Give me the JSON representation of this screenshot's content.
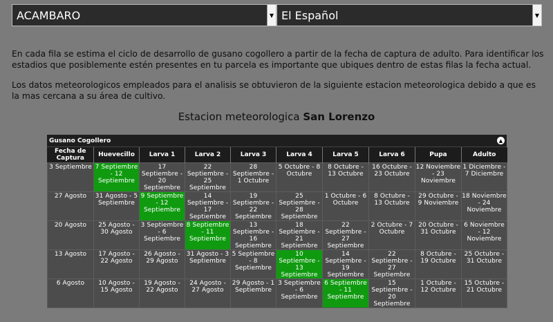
{
  "selects": {
    "city": "ACAMBARO",
    "language": "El Español"
  },
  "intro": {
    "p1": "En cada fila se estima el ciclo de desarrollo de gusano cogollero a partir de la fecha de captura de adulto. Para identificar los estadios que posiblemente estén presentes en tu parcela es importante que ubiques dentro de estas filas la fecha actual.",
    "p2": "Los datos meteorologicos empleados para el analisis se obtuvieron de la siguiente estacion meteorologica debido a que es la mas cercana a su área de cultivo."
  },
  "station": {
    "prefix": "Estacion meteorologica",
    "name": "San Lorenzo"
  },
  "panel": {
    "title": "Gusano Cogollero",
    "columns": [
      "Fecha de Captura",
      "Huevecillo",
      "Larva 1",
      "Larva 2",
      "Larva 3",
      "Larva 4",
      "Larva 5",
      "Larva 6",
      "Pupa",
      "Adulto"
    ],
    "rows": [
      {
        "cells": [
          "3 Septiembre",
          "7 Septiembre - 12 Septiembre",
          "17 Septiembre - 20 Septiembre",
          "22 Septiembre - 25 Septiembre",
          "28 Septiembre - 1 Octubre",
          "5 Octubre - 8 Octubre",
          "8 Octubre - 13 Octubre",
          "16 Octubre - 23 Octubre",
          "12 Noviembre - 23 Noviembre",
          "1 Diciembre - 7 Diciembre"
        ],
        "current": 1
      },
      {
        "cells": [
          "27 Agosto",
          "31 Agosto - 5 Septiembre",
          "9 Septiembre - 12 Septiembre",
          "14 Septiembre - 17 Septiembre",
          "19 Septiembre - 22 Septiembre",
          "25 Septiembre - 28 Septiembre",
          "1 Octubre - 6 Octubre",
          "8 Octubre - 13 Octubre",
          "29 Octubre - 9 Noviembre",
          "18 Noviembre - 24 Noviembre"
        ],
        "current": 2
      },
      {
        "cells": [
          "20 Agosto",
          "25 Agosto - 30 Agosto",
          "3 Septiembre - 6 Septiembre",
          "8 Septiembre - 11 Septiembre",
          "13 Septiembre - 16 Septiembre",
          "18 Septiembre - 21 Septiembre",
          "22 Septiembre - 27 Septiembre",
          "2 Octubre - 7 Octubre",
          "20 Octubre - 31 Octubre",
          "6 Noviembre - 12 Noviembre"
        ],
        "current": 3
      },
      {
        "cells": [
          "13 Agosto",
          "17 Agosto - 22 Agosto",
          "26 Agosto - 29 Agosto",
          "31 Agosto - 3 Septiembre",
          "5 Septiembre - 8 Septiembre",
          "10 Septiembre - 13 Septiembre",
          "14 Septiembre - 19 Septiembre",
          "22 Septiembre - 27 Septiembre",
          "8 Octubre - 19 Octubre",
          "25 Octubre - 31 Octubre"
        ],
        "current": 5
      },
      {
        "cells": [
          "6 Agosto",
          "10 Agosto - 15 Agosto",
          "19 Agosto - 22 Agosto",
          "24 Agosto - 27 Agosto",
          "29 Agosto - 1 Septiembre",
          "3 Septiembre - 6 Septiembre",
          "6 Septiembre - 11 Septiembre",
          "15 Septiembre - 20 Septiembre",
          "1 Octubre - 12 Octubre",
          "15 Octubre - 21 Octubre"
        ],
        "current": 6
      }
    ]
  },
  "colors": {
    "background": "#7b7b7b",
    "header": "#1c1c1c",
    "cell": "#4c4c4c",
    "current": "#109a10"
  }
}
